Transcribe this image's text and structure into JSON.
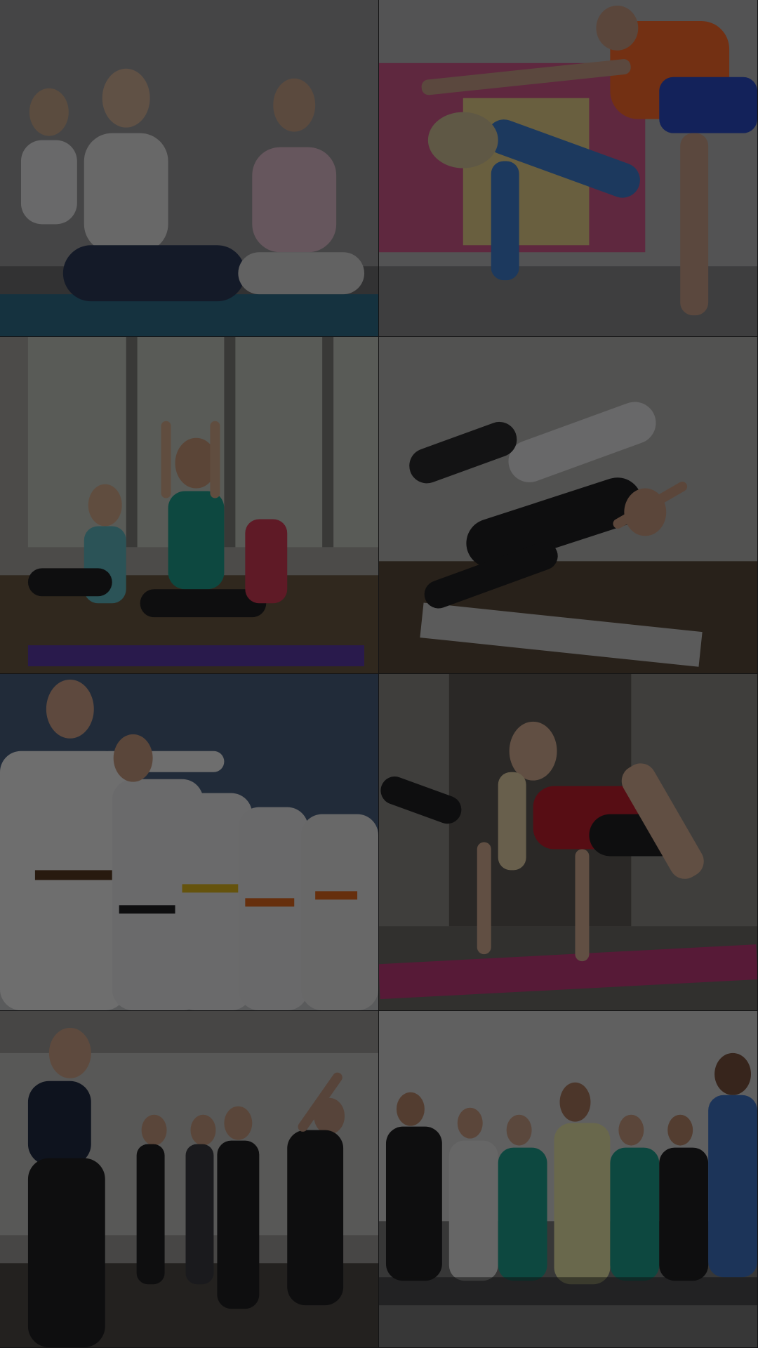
{
  "gallery": {
    "tiles": [
      {
        "id": "yoga-meditation",
        "icon": "photo-icon"
      },
      {
        "id": "yoga-balance-pose",
        "icon": "photo-icon"
      },
      {
        "id": "yoga-lunge-class",
        "icon": "photo-icon"
      },
      {
        "id": "yoga-side-plank",
        "icon": "photo-icon"
      },
      {
        "id": "karate-class",
        "icon": "photo-icon"
      },
      {
        "id": "fitness-kickback",
        "icon": "photo-icon"
      },
      {
        "id": "dance-class",
        "icon": "photo-icon"
      },
      {
        "id": "hiphop-group",
        "icon": "photo-icon"
      }
    ]
  },
  "colors": {
    "background": "#1b1b1d",
    "overlay": "rgba(0,0,0,0.55)"
  }
}
